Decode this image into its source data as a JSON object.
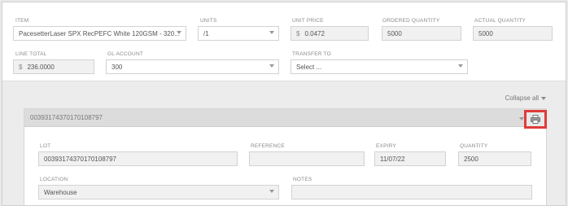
{
  "line": {
    "item": {
      "label": "ITEM",
      "value": "PacesetterLaser SPX RecPEFC White 120GSM - 320..."
    },
    "units": {
      "label": "UNITS",
      "value": "/1"
    },
    "unit_price": {
      "label": "UNIT PRICE",
      "prefix": "$",
      "value": "0.0472"
    },
    "ordered_quantity": {
      "label": "ORDERED QUANTITY",
      "value": "5000"
    },
    "actual_quantity": {
      "label": "ACTUAL QUANTITY",
      "value": "5000"
    },
    "line_total": {
      "label": "LINE TOTAL",
      "prefix": "$",
      "value": "236.0000"
    },
    "gl_account": {
      "label": "GL ACCOUNT",
      "value": "300"
    },
    "transfer_to": {
      "label": "TRANSFER TO",
      "placeholder": "Select ..."
    }
  },
  "collapse_all": "Collapse all",
  "lot_panel": {
    "title": "00393174370170108797",
    "lot": {
      "label": "LOT",
      "value": "00393174370170108797"
    },
    "reference": {
      "label": "REFERENCE",
      "value": ""
    },
    "expiry": {
      "label": "EXPIRY",
      "value": "11/07/22"
    },
    "quantity": {
      "label": "QUANTITY",
      "value": "2500"
    },
    "location": {
      "label": "LOCATION",
      "value": "Warehouse"
    },
    "notes": {
      "label": "NOTES",
      "value": ""
    }
  },
  "icons": {
    "print": "print-icon",
    "highlight_color": "#e03a3a"
  }
}
